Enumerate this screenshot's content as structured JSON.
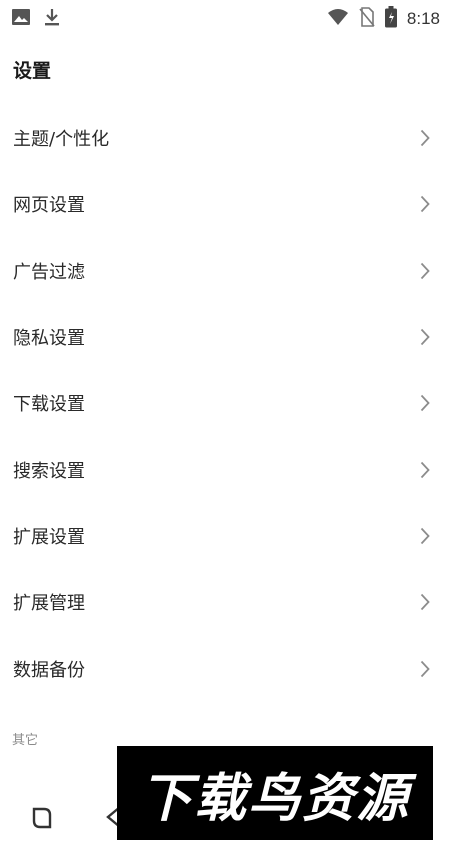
{
  "status_bar": {
    "time": "8:18",
    "icons": [
      "image-icon",
      "download-icon",
      "wifi-icon",
      "no-sim-icon",
      "battery-icon"
    ]
  },
  "page": {
    "title": "设置"
  },
  "menu": {
    "items": [
      {
        "label": "主题/个性化"
      },
      {
        "label": "网页设置"
      },
      {
        "label": "广告过滤"
      },
      {
        "label": "隐私设置"
      },
      {
        "label": "下载设置"
      },
      {
        "label": "搜索设置"
      },
      {
        "label": "扩展设置"
      },
      {
        "label": "扩展管理"
      },
      {
        "label": "数据备份"
      }
    ]
  },
  "section": {
    "other_label": "其它"
  },
  "bottom_nav": {
    "icons": [
      "tabs-icon",
      "back-icon"
    ]
  },
  "watermark": {
    "text": "下载鸟资源"
  },
  "colors": {
    "background": "#ffffff",
    "text": "#2a2a2a",
    "chevron": "#8c8c8c",
    "section": "#8a8a8a"
  }
}
